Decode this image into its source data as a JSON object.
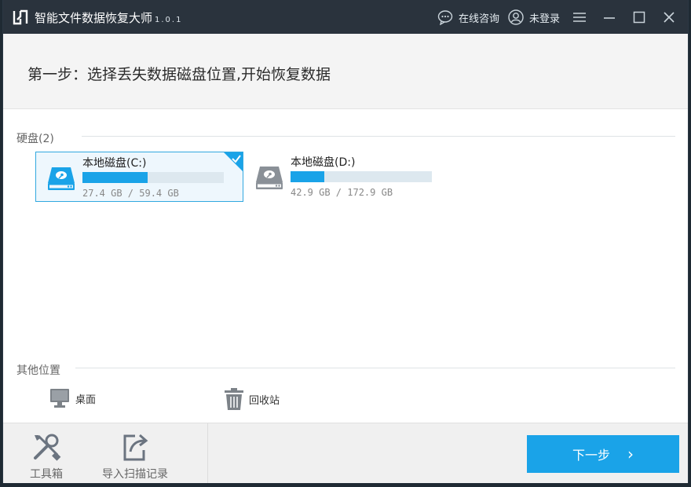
{
  "titlebar": {
    "title": "智能文件数据恢复大师",
    "version": "1.0.1",
    "chat_label": "在线咨询",
    "login_label": "未登录",
    "icons": [
      "logo-icon",
      "chat-icon",
      "user-icon",
      "menu-icon",
      "minimize-icon",
      "maximize-icon",
      "close-icon"
    ]
  },
  "step": {
    "title": "第一步：选择丢失数据磁盘位置,开始恢复数据"
  },
  "disks": {
    "section_label": "硬盘(2)",
    "items": [
      {
        "name": "本地磁盘(C:)",
        "usage": "27.4 GB / 59.4 GB",
        "fill_fraction": 0.46,
        "selected": true
      },
      {
        "name": "本地磁盘(D:)",
        "usage": "42.9 GB / 172.9 GB",
        "fill_fraction": 0.24,
        "selected": false
      }
    ]
  },
  "other": {
    "section_label": "其他位置",
    "items": [
      {
        "label": "桌面",
        "icon": "monitor-icon"
      },
      {
        "label": "回收站",
        "icon": "trash-icon"
      }
    ]
  },
  "footer": {
    "toolbox_label": "工具箱",
    "import_label": "导入扫描记录",
    "next_label": "下一步"
  },
  "colors": {
    "titlebar": "#2a333d",
    "accent": "#1aa3e8",
    "selected_border": "#31a8e0"
  }
}
